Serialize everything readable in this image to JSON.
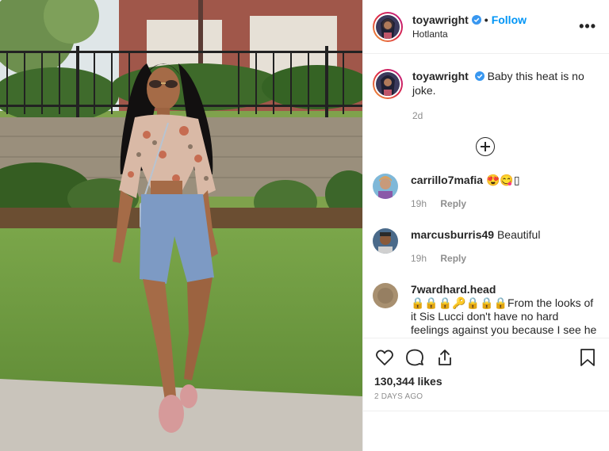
{
  "header": {
    "username": "toyawright",
    "dot": "•",
    "follow_label": "Follow",
    "location": "Hotlanta",
    "more_label": "•••"
  },
  "caption": {
    "username": "toyawright",
    "text": "Baby this heat is no joke.",
    "time": "2d"
  },
  "comments": [
    {
      "username": "carrillo7mafia",
      "text": "😍😋▯",
      "time": "19h",
      "reply_label": "Reply"
    },
    {
      "username": "marcusburris49",
      "text": "Beautiful",
      "time": "19h",
      "reply_label": "Reply"
    },
    {
      "username": "7wardhard.head",
      "text": "🔒🔒🔒🔑🔒🔒🔒From the looks of it Sis Lucci don't have no hard feelings against you because I see he still like",
      "time": "",
      "reply_label": ""
    }
  ],
  "actions": {
    "likes": "130,344 likes",
    "date": "2 DAYS AGO"
  },
  "colors": {
    "follow": "#0095f6",
    "verified": "#3897f0",
    "border": "#efefef",
    "muted": "#8e8e8e"
  },
  "icons": [
    "heart-icon",
    "comment-icon",
    "share-icon",
    "bookmark-icon",
    "verified-badge-icon",
    "more-options-icon",
    "load-more-icon"
  ]
}
